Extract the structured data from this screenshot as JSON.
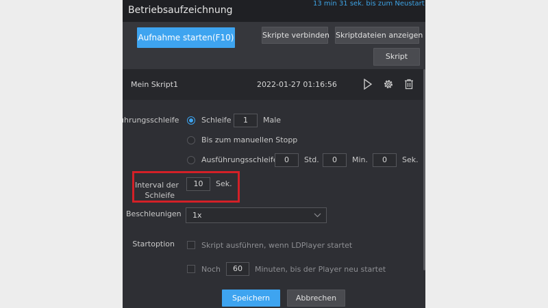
{
  "window": {
    "title": "Betriebsaufzeichnung",
    "restart_notice": "13 min 31 sek. bis zum Neustart"
  },
  "toolbar": {
    "start_recording": "Aufnahme starten(F10)",
    "connect_scripts": "Skripte verbinden",
    "show_script_files": "Skriptdateien anzeigen",
    "script": "Skript"
  },
  "script": {
    "name": "Mein Skript1",
    "datetime": "2022-01-27 01:16:56"
  },
  "form": {
    "loop_label": "ührungsschleife",
    "loop_option_label": "Schleife",
    "loop_count": "1",
    "loop_unit": "Male",
    "manual_stop_label": "Bis zum manuellen Stopp",
    "exec_loop_label": "Ausführungsschleife",
    "exec_hours": "0",
    "exec_hours_unit": "Std.",
    "exec_minutes": "0",
    "exec_minutes_unit": "Min.",
    "exec_seconds": "0",
    "exec_seconds_unit": "Sek.",
    "interval_label_1": "Interval der",
    "interval_label_2": "Schleife",
    "interval_value": "10",
    "interval_unit": "Sek.",
    "accelerate_label": "Beschleunigen",
    "accelerate_value": "1x",
    "start_option_label": "Startoption",
    "run_on_start_label": "Skript ausführen, wenn LDPlayer startet",
    "restart_prefix": "Noch",
    "restart_minutes": "60",
    "restart_suffix": "Minuten, bis der Player neu startet",
    "save": "Speichern",
    "cancel": "Abbrechen"
  },
  "colors": {
    "accent": "#3ea4f0",
    "highlight": "#d42027",
    "panel": "#2e2f34"
  }
}
